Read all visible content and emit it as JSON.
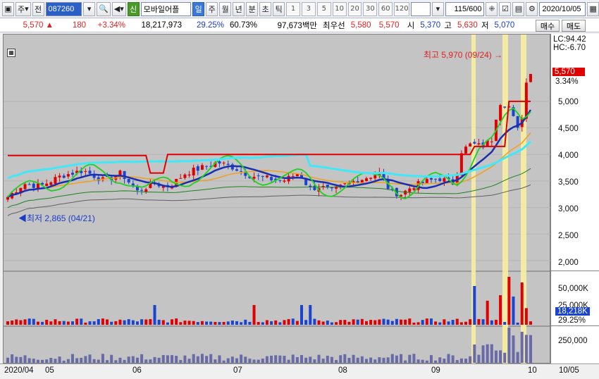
{
  "toolbar": {
    "market_label": "주",
    "type_label": "전",
    "code": "087260",
    "stock_name": "모바일어플",
    "period_buttons": [
      "일",
      "주",
      "월",
      "년",
      "분",
      "초",
      "틱"
    ],
    "tick_numbers": [
      "1",
      "3",
      "5",
      "10",
      "20",
      "30",
      "60",
      "120"
    ],
    "count": "115/600",
    "date": "2020/10/05",
    "badge_label": "신"
  },
  "info": {
    "price": "5,570",
    "change_arrow": "▲",
    "change": "180",
    "change_pct": "+3.34%",
    "volume": "18,217,973",
    "ratio1": "29.25%",
    "ratio2": "60.73%",
    "amount": "97,673백만",
    "best_ask_label": "최우선",
    "best_ask": "5,580",
    "best_bid": "5,570",
    "open_label": "시",
    "open": "5,370",
    "high_label": "고",
    "high": "5,630",
    "low_label": "저",
    "low": "5,070",
    "buy_label": "매수",
    "sell_label": "매도"
  },
  "price_axis": {
    "lc": "LC:94.42",
    "hc": "HC:-6.70",
    "current": "5,570",
    "current_pct": "3.34%",
    "ticks": [
      "5,000",
      "4,500",
      "4,000",
      "3,500",
      "3,000",
      "2,500",
      "2,000"
    ]
  },
  "volume_axis": {
    "ticks": [
      "50,000K",
      "25,000K"
    ],
    "current": "18,218K",
    "current_pct": "29.25%"
  },
  "amount_axis": {
    "ticks": [
      "250,000"
    ]
  },
  "annotations": {
    "high": "최고 5,970 (09/24)",
    "low": "최저 2,865 (04/21)"
  },
  "x_labels": [
    "2020/04",
    "05",
    "06",
    "07",
    "08",
    "09",
    "10",
    "10/05"
  ],
  "colors": {
    "up": "#e00000",
    "down": "#1a44d0",
    "ma_blue": "#1a2fb0",
    "ma_cyan": "#40e8f8",
    "ma_red": "#e00000",
    "ma_green": "#20d020",
    "ma_orange": "#f0a020",
    "highlight": "#f8f0a0"
  },
  "chart_data": {
    "type": "candlestick",
    "price_range": [
      1800,
      6100
    ],
    "high_point": {
      "value": 5970,
      "date": "09/24"
    },
    "low_point": {
      "value": 2865,
      "date": "04/21"
    },
    "last_close": 5570
  }
}
